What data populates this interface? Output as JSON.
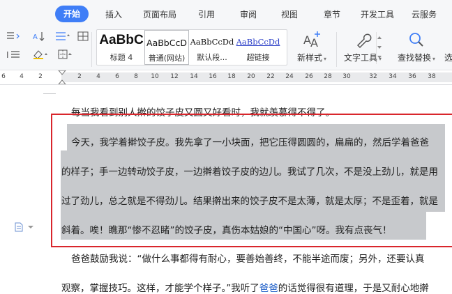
{
  "tabs": [
    {
      "label": "开始",
      "active": true
    },
    {
      "label": "插入"
    },
    {
      "label": "页面布局"
    },
    {
      "label": "引用"
    },
    {
      "label": "审阅"
    },
    {
      "label": "视图"
    },
    {
      "label": "章节"
    },
    {
      "label": "开发工具"
    },
    {
      "label": "云服务"
    }
  ],
  "toolbar": {
    "styles": [
      {
        "preview": "AaBbC",
        "label": "标题 4"
      },
      {
        "preview": "AaBbCcD",
        "label": "普通(网站)"
      },
      {
        "preview": "AaBbCcDd",
        "label": "默认段..."
      },
      {
        "preview": "AaBbCcDd",
        "label": "超链接"
      }
    ],
    "new_style": "新样式",
    "text_tools": "文字工具",
    "find_replace": "查找替换",
    "select_partial": "选"
  },
  "ruler": {
    "ticks": [
      "6",
      "4",
      "2",
      "2",
      "4",
      "6",
      "8",
      "10",
      "12",
      "14",
      "16",
      "18",
      "20",
      "22",
      "24",
      "26",
      "28",
      "30",
      "32",
      "34",
      "36",
      "38"
    ]
  },
  "document": {
    "line1": "每当我看到别人擀的饺子皮又圆又好看时，我就羡慕得不得了。",
    "line2": "今天，我学着擀饺子皮。我先拿了一小块面，把它压得圆圆的，扁扁的，然后学着爸爸",
    "line3": "的样子；手一边转动饺子皮，一边擀着饺子皮的边儿。我试了几次，不是没上劲儿，就是用",
    "line4": "过了劲儿，总之就是不得劲儿。结果擀出来的饺子皮不是太薄，就是太厚；不是歪着，就是",
    "line5": "斜着。唉！瞧那“惨不忍睹”的饺子皮，真伤本姑娘的“中国心”呀。我有点丧气！",
    "line6": "爸爸鼓励我说：“做什么事都得有耐心，要善始善终，不能半途而废；另外，还要认真",
    "line7_a": "观察，掌握技巧。这样，才能学个样子。”我听了",
    "line7_link": "爸爸",
    "line7_b": "的话觉得很有道理，于是又耐心地擀"
  },
  "colors": {
    "tab_active_bg": "#3f7ef7",
    "selection_bg": "#c7c9cc",
    "annotation_box": "#d9262c",
    "link": "#2060c8"
  }
}
